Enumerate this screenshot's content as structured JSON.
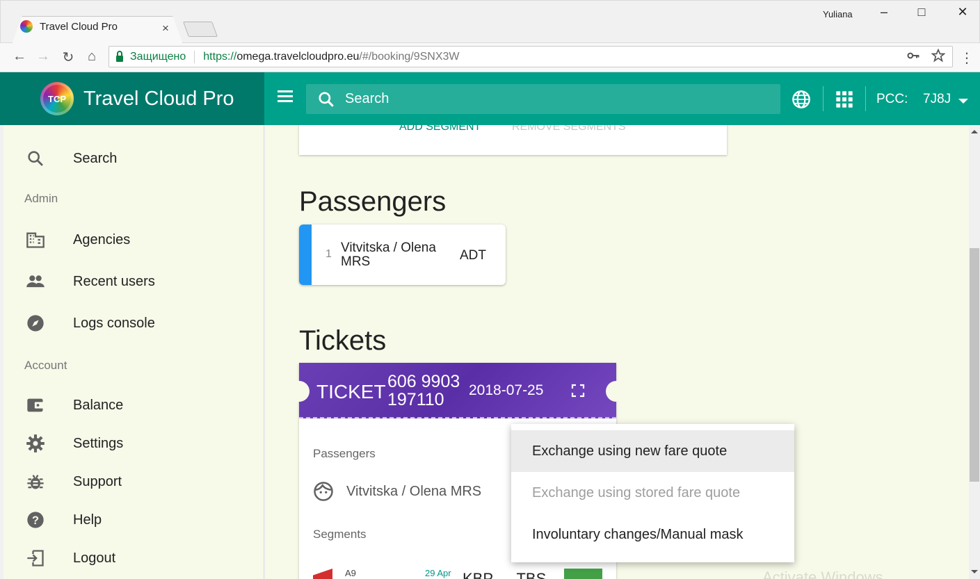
{
  "browser": {
    "tab_title": "Travel Cloud Pro",
    "tab_close": "×",
    "user": "Yuliana",
    "secure_label": "Защищено",
    "url_scheme": "https://",
    "url_host": "omega.travelcloudpro.eu",
    "url_rest": "/#/booking/9SNX3W"
  },
  "app": {
    "brand_name": "Travel Cloud Pro",
    "logo_text": "TCP",
    "search_placeholder": "Search",
    "pcc_label": "PCC:",
    "pcc_value": "7J8J"
  },
  "sidebar": {
    "search": "Search",
    "admin_section": "Admin",
    "agencies": "Agencies",
    "recent_users": "Recent users",
    "logs_console": "Logs console",
    "account_section": "Account",
    "balance": "Balance",
    "settings": "Settings",
    "support": "Support",
    "help": "Help",
    "logout": "Logout"
  },
  "segments_card": {
    "add_segment": "ADD SEGMENT",
    "remove_segments": "REMOVE SEGMENTS"
  },
  "passengers": {
    "heading": "Passengers",
    "items": [
      {
        "num": "1",
        "name": "Vitvitska / Olena MRS",
        "type": "ADT"
      }
    ]
  },
  "tickets": {
    "heading": "Tickets",
    "ticket_label": "TICKET",
    "number": "606 9903 197110",
    "date": "2018-07-25",
    "passengers_label": "Passengers",
    "passenger_name": "Vitvitska / Olena MRS",
    "segments_label": "Segments",
    "segment_carrier": "A9",
    "segment_date": "29 Apr",
    "segment_route": "KBP — TBS"
  },
  "menu": {
    "items": [
      {
        "label": "Exchange using new fare quote",
        "state": "active"
      },
      {
        "label": "Exchange using stored fare quote",
        "state": "disabled"
      },
      {
        "label": "Involuntary changes/Manual mask",
        "state": "normal"
      }
    ]
  },
  "colors": {
    "header": "#00a18a",
    "brand_bg": "#00796b",
    "ticket": "#5a2ea6",
    "pax_accent": "#2196f3",
    "page_bg": "#f7f9e9"
  },
  "watermark": "Activate Windows"
}
